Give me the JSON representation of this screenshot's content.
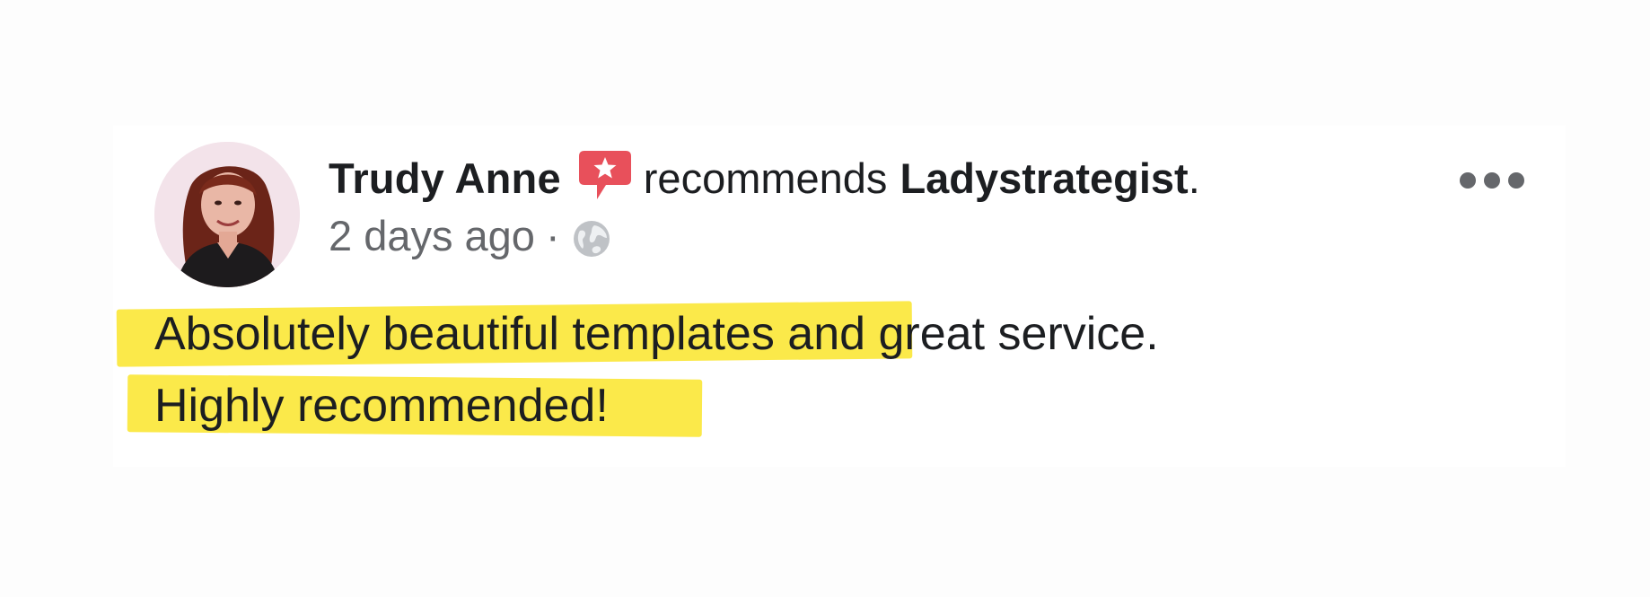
{
  "post": {
    "author": "Trudy Anne",
    "action_text": "recommends",
    "page_name": "Ladystrategist",
    "period": ".",
    "timestamp": "2 days ago",
    "separator": "·",
    "privacy_icon": "globe-icon",
    "recommend_icon": "recommendation-star-icon",
    "more_icon": "more-options-icon"
  },
  "review": {
    "line1_highlighted": "Absolutely beautiful templates",
    "line1_rest": " and great service.",
    "line2_highlighted": "Highly recommended!"
  },
  "colors": {
    "highlight": "#fbe94a",
    "recommend_icon": "#e8505b",
    "secondary_text": "#65676b",
    "primary_text": "#1c1e21"
  }
}
